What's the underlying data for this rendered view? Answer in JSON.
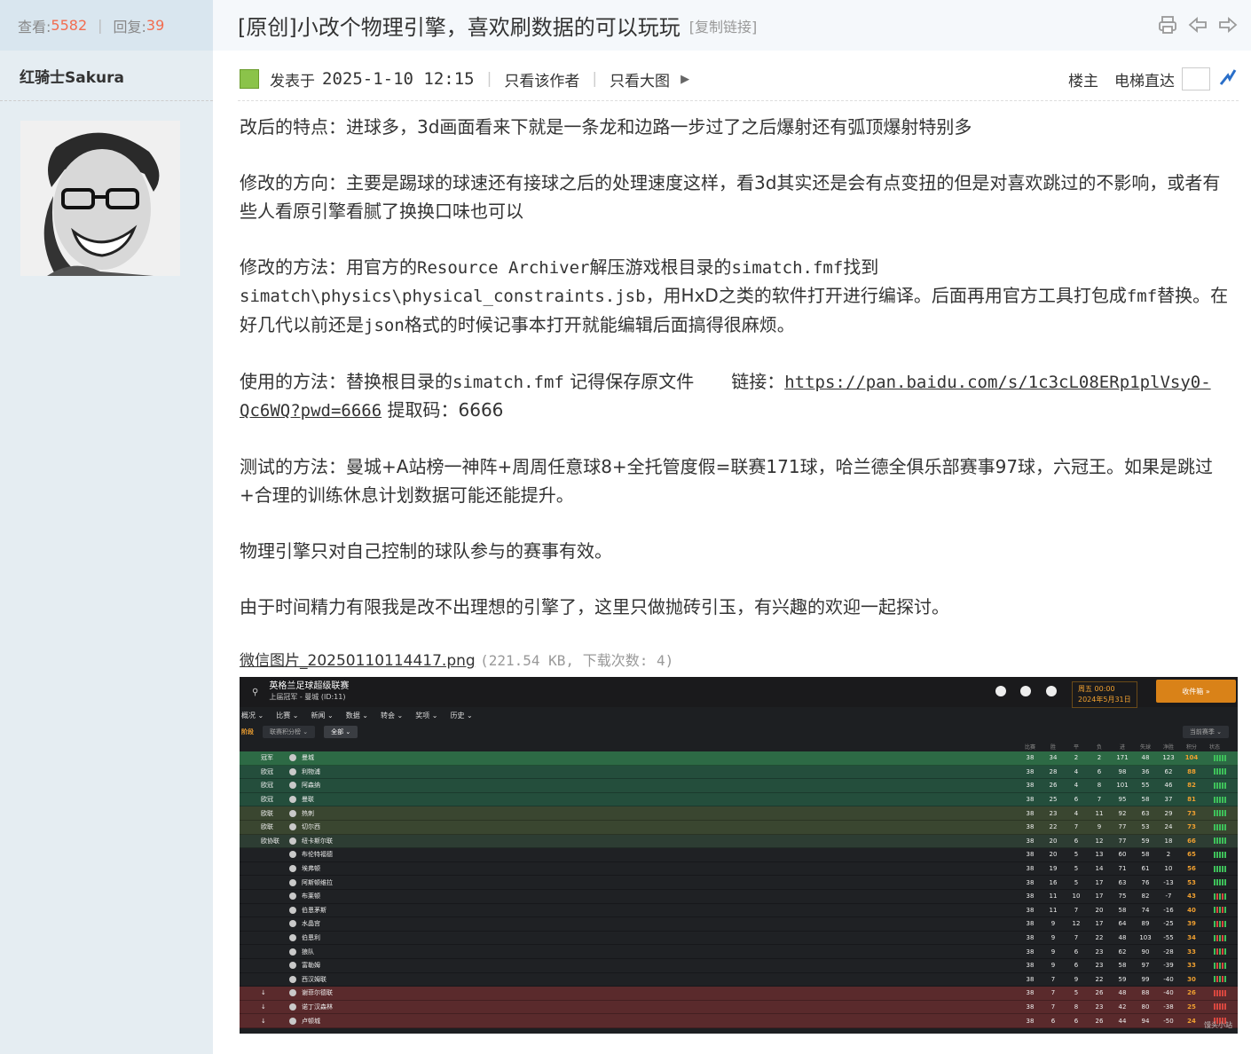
{
  "sidebar": {
    "views_label": "查看:",
    "views_value": "5582",
    "replies_label": "回复:",
    "replies_value": "39",
    "author_name": "红骑士Sakura"
  },
  "thread": {
    "title": "[原创]小改个物理引擎，喜欢刷数据的可以玩玩",
    "copy_link": "[复制链接]"
  },
  "post": {
    "posted_label": "发表于",
    "posted_time": "2025-1-10 12:15",
    "only_author": "只看该作者",
    "only_images": "只看大图",
    "floor": "楼主",
    "elevator": "电梯直达"
  },
  "content": {
    "p1": "改后的特点：进球多，3d画面看来下就是一条龙和边路一步过了之后爆射还有弧顶爆射特别多",
    "p2": "修改的方向：主要是踢球的球速还有接球之后的处理速度这样，看3d其实还是会有点变扭的但是对喜欢跳过的不影响，或者有些人看原引擎看腻了换换口味也可以",
    "p3a": "修改的方法：用官方的",
    "p3b": "Resource Archiver",
    "p3c": "解压游戏根目录的",
    "p3d": "simatch.fmf",
    "p3e": "找到",
    "p3f": "simatch\\physics\\physical_constraints.jsb",
    "p3g": "，用HxD之类的软件打开进行编译。后面再用官方工具打包成",
    "p3h": "fmf",
    "p3i": "替换。在好几代以前还是",
    "p3j": "json",
    "p3k": "格式的时候记事本打开就能编辑后面搞得很麻烦。",
    "p4a": "使用的方法：替换根目录的",
    "p4b": "simatch.fmf",
    "p4c": " 记得保存原文件",
    "p4d": "链接：",
    "p4_link": "https://pan.baidu.com/s/1c3cL08ERp1plVsy0-Qc6WQ?pwd=6666",
    "p4e": " 提取码：6666",
    "p5": "测试的方法：曼城+A站榜一神阵+周周任意球8+全托管度假=联赛171球，哈兰德全俱乐部赛事97球，六冠王。如果是跳过+合理的训练休息计划数据可能还能提升。",
    "p6": "物理引擎只对自己控制的球队参与的赛事有效。",
    "p7": "由于时间精力有限我是改不出理想的引擎了，这里只做抛砖引玉，有兴趣的欢迎一起探讨。"
  },
  "attachment": {
    "filename": "微信图片_20250110114417.png",
    "meta": "(221.54 KB, 下载次数: 4)"
  },
  "screenshot": {
    "league": "英格兰足球超级联赛",
    "last_champion": "上届冠军 - 曼城 (ID:11)",
    "date_line1": "周五 00:00",
    "date_line2": "2024年5月31日",
    "continue": "收件箱 »",
    "menu": [
      "概况 ⌄",
      "比赛 ⌄",
      "新闻 ⌄",
      "数据 ⌄",
      "转会 ⌄",
      "奖项 ⌄",
      "历史 ⌄"
    ],
    "filter1": "阶段",
    "filter2": "联赛积分榜 ⌄",
    "filter3": "全部 ⌄",
    "season": "当前赛季 ⌄",
    "headers": [
      "比赛",
      "胜",
      "平",
      "负",
      "进",
      "失球",
      "净胜",
      "积分",
      "状态"
    ],
    "rows": [
      {
        "q": "冠军",
        "team": "曼城",
        "s": [
          "38",
          "34",
          "2",
          "2",
          "171",
          "48",
          "123",
          "104"
        ],
        "cls": "champ"
      },
      {
        "q": "欧冠",
        "team": "利物浦",
        "s": [
          "38",
          "28",
          "4",
          "6",
          "98",
          "36",
          "62",
          "88"
        ],
        "cls": "cl"
      },
      {
        "q": "欧冠",
        "team": "阿森纳",
        "s": [
          "38",
          "26",
          "4",
          "8",
          "101",
          "55",
          "46",
          "82"
        ],
        "cls": "cl"
      },
      {
        "q": "欧冠",
        "team": "曼联",
        "s": [
          "38",
          "25",
          "6",
          "7",
          "95",
          "58",
          "37",
          "81"
        ],
        "cls": "cl"
      },
      {
        "q": "欧联",
        "team": "热刺",
        "s": [
          "38",
          "23",
          "4",
          "11",
          "92",
          "63",
          "29",
          "73"
        ],
        "cls": "el"
      },
      {
        "q": "欧联",
        "team": "切尔西",
        "s": [
          "38",
          "22",
          "7",
          "9",
          "77",
          "53",
          "24",
          "73"
        ],
        "cls": "el"
      },
      {
        "q": "欧协联",
        "team": "纽卡斯尔联",
        "s": [
          "38",
          "20",
          "6",
          "12",
          "77",
          "59",
          "18",
          "66"
        ],
        "cls": "conf"
      },
      {
        "q": "",
        "team": "布伦特福德",
        "s": [
          "38",
          "20",
          "5",
          "13",
          "60",
          "58",
          "2",
          "65"
        ],
        "cls": "mid"
      },
      {
        "q": "",
        "team": "埃弗顿",
        "s": [
          "38",
          "19",
          "5",
          "14",
          "71",
          "61",
          "10",
          "56"
        ],
        "cls": "mid"
      },
      {
        "q": "",
        "team": "阿斯顿维拉",
        "s": [
          "38",
          "16",
          "5",
          "17",
          "63",
          "76",
          "-13",
          "53"
        ],
        "cls": "mid"
      },
      {
        "q": "",
        "team": "布莱顿",
        "s": [
          "38",
          "11",
          "10",
          "17",
          "75",
          "82",
          "-7",
          "43"
        ],
        "cls": "mid"
      },
      {
        "q": "",
        "team": "伯恩茅斯",
        "s": [
          "38",
          "11",
          "7",
          "20",
          "58",
          "74",
          "-16",
          "40"
        ],
        "cls": "mid"
      },
      {
        "q": "",
        "team": "水晶宫",
        "s": [
          "38",
          "9",
          "12",
          "17",
          "64",
          "89",
          "-25",
          "39"
        ],
        "cls": "mid"
      },
      {
        "q": "",
        "team": "伯恩利",
        "s": [
          "38",
          "9",
          "7",
          "22",
          "48",
          "103",
          "-55",
          "34"
        ],
        "cls": "mid"
      },
      {
        "q": "",
        "team": "狼队",
        "s": [
          "38",
          "9",
          "6",
          "23",
          "62",
          "90",
          "-28",
          "33"
        ],
        "cls": "mid"
      },
      {
        "q": "",
        "team": "富勒姆",
        "s": [
          "38",
          "9",
          "6",
          "23",
          "58",
          "97",
          "-39",
          "33"
        ],
        "cls": "mid"
      },
      {
        "q": "",
        "team": "西汉姆联",
        "s": [
          "38",
          "7",
          "9",
          "22",
          "59",
          "99",
          "-40",
          "30"
        ],
        "cls": "mid"
      },
      {
        "q": "↓",
        "team": "谢菲尔德联",
        "s": [
          "38",
          "7",
          "5",
          "26",
          "48",
          "88",
          "-40",
          "26"
        ],
        "cls": "rel"
      },
      {
        "q": "↓",
        "team": "诺丁汉森林",
        "s": [
          "38",
          "7",
          "8",
          "23",
          "42",
          "80",
          "-38",
          "25"
        ],
        "cls": "rel"
      },
      {
        "q": "↓",
        "team": "卢顿城",
        "s": [
          "38",
          "6",
          "6",
          "26",
          "44",
          "94",
          "-50",
          "24"
        ],
        "cls": "rel"
      }
    ],
    "watermark": "馒头小站"
  },
  "colors": {
    "accent": "#f26c4f",
    "sidebar_bg": "#e5edf2"
  }
}
